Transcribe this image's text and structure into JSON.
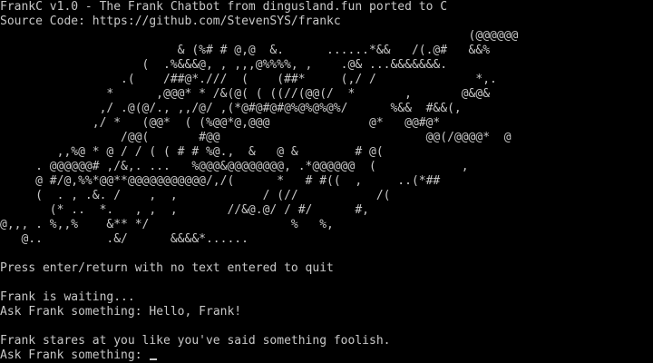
{
  "header": {
    "title_line": "FrankC v1.0 - The Frank Chatbot from dingusland.fun ported to C",
    "source_line": "Source Code: https://github.com/StevenSYS/frankc"
  },
  "ascii_art": [
    "                                                                  (@@@@@@",
    "                         & (%# # @,@  &.      ......*&&   /(.@#   &&%",
    "                    (  .%&&&@, , ,,,@%%%%, ,    .@& ...&&&&&&&.",
    "                 .(    /##@*.///  (    (##*     (,/ /              *,.",
    "               *      ,@@@* * /&(@( ( ((//(@@(/  *       ,       @&@&",
    "              ,/ .@(@/., ,,/@/ ,(*@#@#@#@%@%@%@%/      %&&  #&&(,",
    "             ,/ *   (@@*  ( (%@@*@,@@@              @*   @@#@*",
    "                 /@@(       #@@                             @@(/@@@@*  @",
    "        ,,%@ * @ / / ( ( # # %@.,  &   @ &        # @(",
    "     . @@@@@@# ,/&,. ...   %@@@&@@@@@@@@, .*@@@@@@  (            ,",
    "     @ #/@,%%*@@**@@@@@@@@@@@/,/(      *   # #((  ,     ..(*##",
    "     (  . , .&. /    ,  ,            / (//           /(",
    "       (* ..  *.   , ,  ,       //&@.@/ / #/      #,",
    "@,,, . %,,%    &** */                    %   %,",
    "   @..         .&/      &&&&*......"
  ],
  "instructions": "Press enter/return with no text entered to quit",
  "status": "Frank is waiting...",
  "ask_prompt_1": "Ask Frank something: ",
  "user_input_1": "Hello, Frank!",
  "frank_reply": "Frank stares at you like you've said something foolish.",
  "ask_prompt_2": "Ask Frank something: ",
  "current_input": ""
}
